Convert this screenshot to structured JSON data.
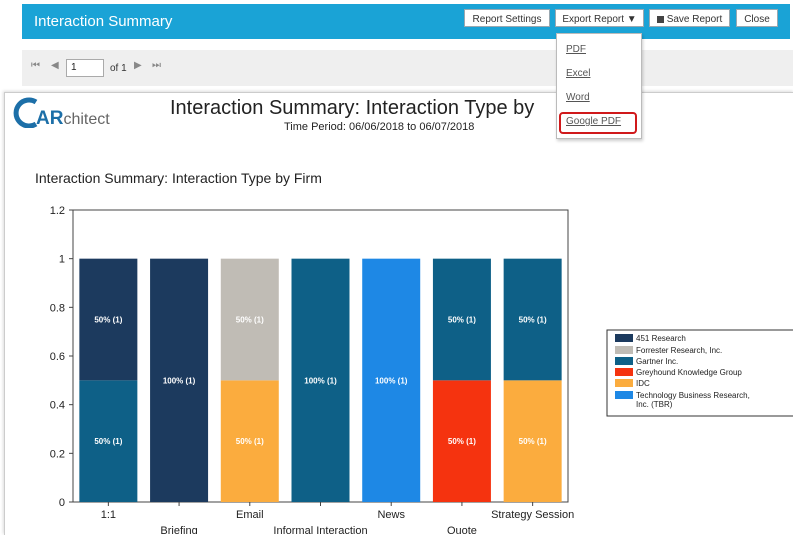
{
  "header": {
    "title": "Interaction Summary",
    "report_settings": "Report Settings",
    "export_report": "Export Report ▼",
    "save_report": "Save Report",
    "close": "Close"
  },
  "export_menu": [
    "PDF",
    "Excel",
    "Word",
    "Google PDF"
  ],
  "pager": {
    "page": "1",
    "of_label": "of 1"
  },
  "report": {
    "logo_text": "ARchitect",
    "title": "Interaction Summary: Interaction Type by",
    "time_period": "Time Period:  06/06/2018 to 06/07/2018",
    "chart_title": "Interaction Summary: Interaction Type by Firm"
  },
  "colors": {
    "header": "#1aa3d6",
    "highlight": "#d0191b"
  },
  "chart_data": {
    "type": "bar",
    "stacked": true,
    "title": "Interaction Summary: Interaction Type by Firm",
    "categories": [
      "1:1",
      "Briefing",
      "Email",
      "Informal Interaction",
      "News",
      "Quote",
      "Strategy Session"
    ],
    "ylim": [
      0,
      1.2
    ],
    "yticks": [
      "0",
      "0.2",
      "0.4",
      "0.6",
      "0.8",
      "1",
      "1.2"
    ],
    "legend_position": "right",
    "series": [
      {
        "name": "451 Research",
        "color": "#1c3a5e",
        "values": [
          0.5,
          1,
          0,
          0,
          0,
          0,
          0
        ],
        "labels": [
          "50% (1)",
          "100% (1)",
          "",
          "",
          "",
          "",
          ""
        ]
      },
      {
        "name": "Forrester Research, Inc.",
        "color": "#c0bcb5",
        "values": [
          0,
          0,
          0.5,
          0,
          0,
          0,
          0
        ],
        "labels": [
          "",
          "",
          "50% (1)",
          "",
          "",
          "",
          ""
        ]
      },
      {
        "name": "Gartner Inc.",
        "color": "#0e6087",
        "values": [
          0.5,
          0,
          0,
          1,
          0,
          0.5,
          0.5
        ],
        "labels": [
          "50% (1)",
          "",
          "",
          "100% (1)",
          "",
          "50% (1)",
          "50% (1)"
        ]
      },
      {
        "name": "Greyhound Knowledge Group",
        "color": "#f5330f",
        "values": [
          0,
          0,
          0,
          0,
          0,
          0.5,
          0
        ],
        "labels": [
          "",
          "",
          "",
          "",
          "",
          "50% (1)",
          ""
        ]
      },
      {
        "name": "IDC",
        "color": "#fbac3e",
        "values": [
          0,
          0,
          0.5,
          0,
          0,
          0,
          0.5
        ],
        "labels": [
          "",
          "",
          "50% (1)",
          "",
          "",
          "",
          "50% (1)"
        ]
      },
      {
        "name": "Technology Business Research, Inc. (TBR)",
        "color": "#1e88e5",
        "values": [
          0,
          0,
          0,
          0,
          1,
          0,
          0
        ],
        "labels": [
          "",
          "",
          "",
          "",
          "100% (1)",
          "",
          ""
        ]
      }
    ],
    "stack_order": [
      [
        2,
        0
      ],
      [
        0
      ],
      [
        4,
        1
      ],
      [
        2
      ],
      [
        5
      ],
      [
        3,
        2
      ],
      [
        4,
        2
      ]
    ]
  }
}
